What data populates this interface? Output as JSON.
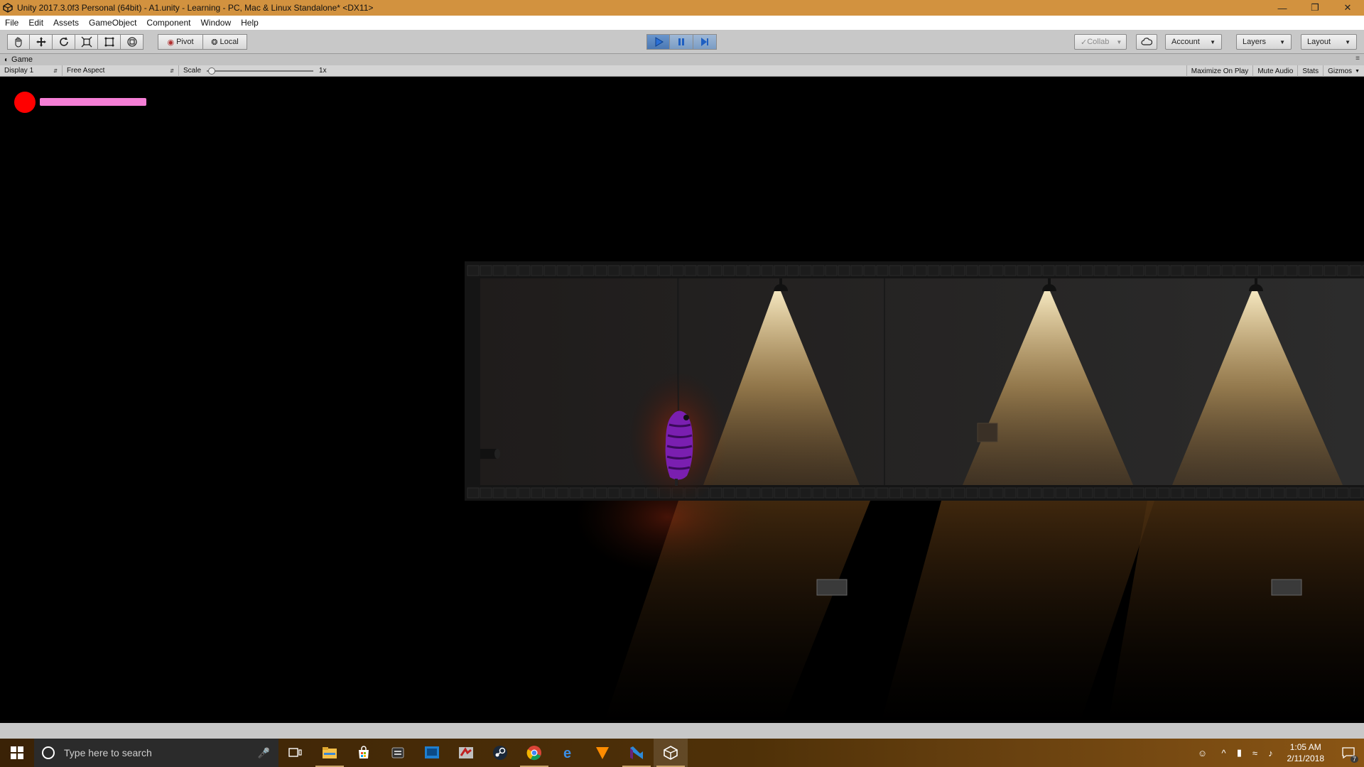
{
  "window": {
    "title": "Unity 2017.3.0f3 Personal (64bit) - A1.unity - Learning - PC, Mac & Linux Standalone* <DX11>",
    "app_icon": "unity-icon",
    "controls": [
      "minimize-icon",
      "restore-icon",
      "close-icon"
    ]
  },
  "menu": [
    "File",
    "Edit",
    "Assets",
    "GameObject",
    "Component",
    "Window",
    "Help"
  ],
  "toolbar": {
    "tools": [
      "hand-tool-icon",
      "move-tool-icon",
      "rotate-tool-icon",
      "scale-tool-icon",
      "rect-tool-icon",
      "transform-tool-icon"
    ],
    "pivot_label": "Pivot",
    "local_label": "Local",
    "play_controls": [
      "play-icon",
      "pause-icon",
      "step-icon"
    ],
    "play_active": true,
    "collab_label": "Collab",
    "account_label": "Account",
    "layers_label": "Layers",
    "layout_label": "Layout"
  },
  "game_panel": {
    "tab_label": "Game",
    "display_label": "Display 1",
    "aspect_label": "Free Aspect",
    "scale_label": "Scale",
    "scale_value": "1x",
    "scale_level": 0,
    "maximize_label": "Maximize On Play",
    "mute_label": "Mute Audio",
    "stats_label": "Stats",
    "gizmos_label": "Gizmos"
  },
  "hud": {
    "indicator_color": "#ff0000",
    "health_color": "#f57fd6",
    "health_fraction": 1.0
  },
  "scene": {
    "player_color": "#7a1fb0",
    "light_color": "#ffe7b0",
    "lamp_count": 3
  },
  "taskbar": {
    "search_placeholder": "Type here to search",
    "apps": [
      "task-view-icon",
      "file-explorer-icon",
      "store-icon",
      "app-icon",
      "window-app-icon",
      "game-app-icon",
      "steam-icon",
      "chrome-icon",
      "edge-icon",
      "vlc-icon",
      "visual-studio-icon",
      "unity-icon"
    ],
    "time": "1:05 AM",
    "date": "2/11/2018",
    "notification_count": "7"
  }
}
